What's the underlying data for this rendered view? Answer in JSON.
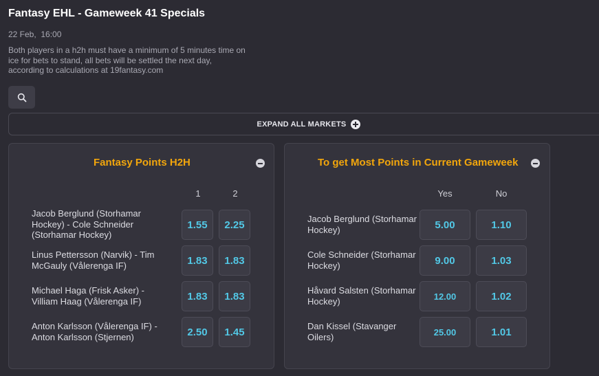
{
  "header": {
    "title": "Fantasy EHL - Gameweek 41 Specials",
    "date": "22 Feb,  16:00",
    "description": "Both players in a h2h must have a minimum of 5 minutes time on ice for bets to stand, all bets will be settled the next day, according to calculations at 19fantasy.com"
  },
  "toolbar": {
    "search_icon": "search-icon",
    "expand_label": "EXPAND ALL MARKETS",
    "expand_icon": "plus-circle-icon"
  },
  "colors": {
    "accent": "#f2a60c",
    "odds": "#52c8e6",
    "background": "#2c2b33",
    "panel": "#34333c"
  },
  "markets": [
    {
      "title": "Fantasy Points H2H",
      "columns": [
        "1",
        "2"
      ],
      "rows": [
        {
          "label": "Jacob Berglund (Storhamar Hockey) - Cole Schneider (Storhamar Hockey)",
          "odds": [
            "1.55",
            "2.25"
          ]
        },
        {
          "label": "Linus Pettersson (Narvik) - Tim McGauly (Vålerenga IF)",
          "odds": [
            "1.83",
            "1.83"
          ]
        },
        {
          "label": "Michael Haga (Frisk Asker) - Villiam Haag (Vålerenga IF)",
          "odds": [
            "1.83",
            "1.83"
          ]
        },
        {
          "label": "Anton Karlsson (Vålerenga IF) - Anton Karlsson (Stjernen)",
          "odds": [
            "2.50",
            "1.45"
          ]
        }
      ]
    },
    {
      "title": "To get Most Points in Current Gameweek",
      "columns": [
        "Yes",
        "No"
      ],
      "rows": [
        {
          "label": "Jacob Berglund (Storhamar Hockey)",
          "odds": [
            "5.00",
            "1.10"
          ]
        },
        {
          "label": "Cole Schneider (Storhamar Hockey)",
          "odds": [
            "9.00",
            "1.03"
          ]
        },
        {
          "label": "Håvard Salsten (Storhamar Hockey)",
          "odds": [
            "12.00",
            "1.02"
          ]
        },
        {
          "label": "Dan Kissel (Stavanger Oilers)",
          "odds": [
            "25.00",
            "1.01"
          ]
        }
      ]
    }
  ]
}
